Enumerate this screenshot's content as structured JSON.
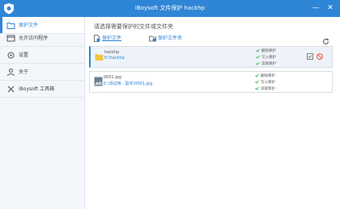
{
  "window": {
    "title": "iBoysoft 文件保护 hackhp",
    "minimize": "—",
    "close": "✕"
  },
  "sidebar": {
    "items": [
      {
        "label": "保护文件",
        "icon": "folder-lock-icon",
        "active": true
      },
      {
        "label": "允许访问程序",
        "icon": "app-window-icon",
        "active": false
      },
      {
        "label": "设置",
        "icon": "gear-icon",
        "active": false
      },
      {
        "label": "关于",
        "icon": "person-icon",
        "active": false
      },
      {
        "label": "iBoysoft 工具箱",
        "icon": "tools-icon",
        "active": false
      }
    ]
  },
  "main": {
    "instruction": "请选择需要保护的文件或文件夹",
    "actions": {
      "protect_file": "保护文件",
      "protect_folder": "保护文件夹"
    },
    "rows": [
      {
        "type": "folder",
        "name": "hackhp",
        "path": "E:\\hackhp",
        "perms": [
          "删除保护",
          "写入保护",
          "读取保护"
        ]
      },
      {
        "type": "image",
        "name": "0001.jpg",
        "path": "E:\\测试用 - 副本\\0001.jpg",
        "perms": [
          "删除保护",
          "写入保护",
          "读取保护"
        ]
      }
    ]
  },
  "colors": {
    "accent": "#2f85d6",
    "check": "#2fae44",
    "remove": "#e0452e"
  }
}
